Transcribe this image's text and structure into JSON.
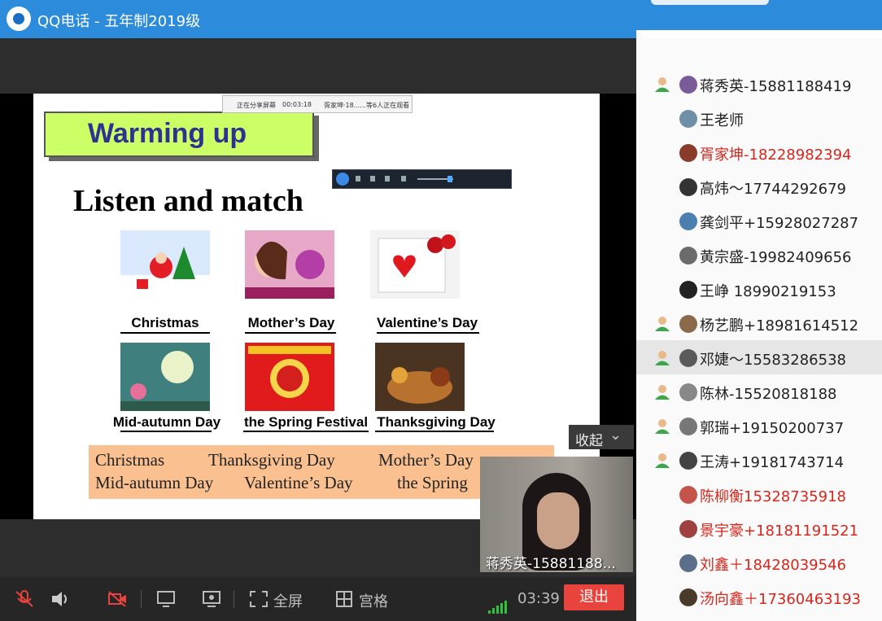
{
  "window": {
    "title": "QQ电话 - 五年制2019级"
  },
  "slide": {
    "heading": "Warming up",
    "title": "Listen and match",
    "share_note": {
      "status": "正在分享屏幕",
      "time": "00:03:18",
      "viewers": "胥家坤·18......等6人正在观看"
    },
    "pictures": [
      {
        "label": "Christmas",
        "icon": "christmas-picture"
      },
      {
        "label": "Mother’s Day",
        "icon": "mothers-day-picture"
      },
      {
        "label": "Valentine’s Day",
        "icon": "valentines-day-picture"
      },
      {
        "label": "Mid-autumn Day",
        "icon": "mid-autumn-picture"
      },
      {
        "label": "the Spring Festival",
        "icon": "spring-festival-picture"
      },
      {
        "label": "Thanksgiving Day",
        "icon": "thanksgiving-picture"
      }
    ],
    "answers": [
      "Christmas",
      "Thanksgiving Day",
      "Mother’s Day",
      "Mid-autumn Day",
      "Valentine’s Day",
      "the Spring"
    ]
  },
  "collapse_label": "收起",
  "camera": {
    "name": "蒋秀英-15881188..."
  },
  "toolbar": {
    "fullscreen": "全屏",
    "grid": "宫格",
    "time": "03:39",
    "exit": "退出"
  },
  "members": [
    {
      "name": "蒋秀英-15881188419",
      "color": "#222222",
      "host": true
    },
    {
      "name": "王老师",
      "color": "#222222",
      "host": false
    },
    {
      "name": "胥家坤-18228982394",
      "color": "#d9261c",
      "host": false
    },
    {
      "name": "高炜～17744292679",
      "color": "#222222",
      "host": false
    },
    {
      "name": "龚剑平+15928027287",
      "color": "#222222",
      "host": false
    },
    {
      "name": "黄宗盛-19982409656",
      "color": "#222222",
      "host": false
    },
    {
      "name": "王峥 18990219153",
      "color": "#222222",
      "host": false
    },
    {
      "name": "杨艺鹏+18981614512",
      "color": "#222222",
      "host": true
    },
    {
      "name": "邓婕～15583286538",
      "color": "#222222",
      "host": true
    },
    {
      "name": "陈林-15520818188",
      "color": "#222222",
      "host": true
    },
    {
      "name": "郭瑞+19150200737",
      "color": "#222222",
      "host": true
    },
    {
      "name": "王涛+19181743714",
      "color": "#222222",
      "host": true
    },
    {
      "name": "陈柳衡15328735918",
      "color": "#d9261c",
      "host": false
    },
    {
      "name": "景宇豪+18181191521",
      "color": "#d9261c",
      "host": false
    },
    {
      "name": "刘鑫＋18428039546",
      "color": "#d9261c",
      "host": false
    },
    {
      "name": "汤向鑫＋17360463193",
      "color": "#d9261c",
      "host": false
    }
  ]
}
